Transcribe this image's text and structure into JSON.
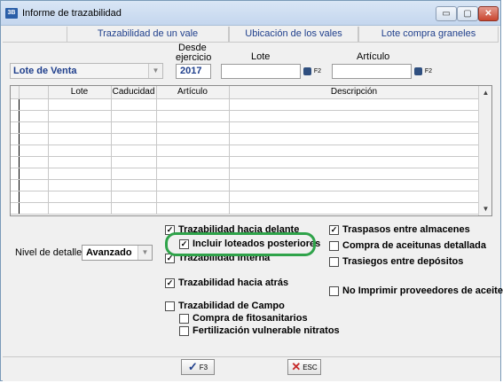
{
  "window": {
    "app_icon": "3B",
    "title": "Informe de trazabilidad",
    "min_icon": "minimize-icon",
    "max_icon": "maximize-icon",
    "close_icon": "close-icon",
    "min_symbol": "▭",
    "max_symbol": "▢",
    "close_symbol": "✕"
  },
  "tabs": [
    "Trazabilidad de un vale",
    "Ubicación de los vales",
    "Lote compra graneles"
  ],
  "filters": {
    "type_combo": "Lote de Venta",
    "desde_label_1": "Desde",
    "desde_label_2": "ejercicio",
    "year": "2017",
    "lote_label": "Lote",
    "lote_value": "",
    "articulo_label": "Artículo",
    "articulo_value": "",
    "f2_label": "F2"
  },
  "grid": {
    "columns": [
      "Lote",
      "Caducidad",
      "Artículo",
      "Descripción"
    ],
    "row_count": 10,
    "scroll_up": "▲",
    "scroll_down": "▼"
  },
  "options": {
    "detail_label": "Nivel de detalle:",
    "detail_value": "Avanzado",
    "left": [
      {
        "label": "Trazabilidad hacia delante",
        "checked": true
      },
      {
        "label": "Incluir loteados posteriores",
        "checked": true
      },
      {
        "label": "Trazabilidad interna",
        "checked": true
      },
      {
        "label": "Trazabilidad hacia atrás",
        "checked": true
      },
      {
        "label": "Trazabilidad de Campo",
        "checked": false
      },
      {
        "label": "Compra de fitosanitarios",
        "checked": false
      },
      {
        "label": "Fertilización vulnerable nitratos",
        "checked": false
      }
    ],
    "right": [
      {
        "label": "Traspasos entre almacenes",
        "checked": true
      },
      {
        "label": "Compra de aceitunas detallada",
        "checked": false
      },
      {
        "label": "Trasiegos entre depósitos",
        "checked": false
      },
      {
        "label": "No Imprimir proveedores de aceite",
        "checked": false
      }
    ],
    "check_mark": "✓"
  },
  "buttons": {
    "ok_symbol": "✓",
    "ok_label": "F3",
    "esc_symbol": "✕",
    "esc_label": "ESC"
  },
  "colors": {
    "highlight": "#2fa34a",
    "accent_text": "#1f3f8c"
  }
}
